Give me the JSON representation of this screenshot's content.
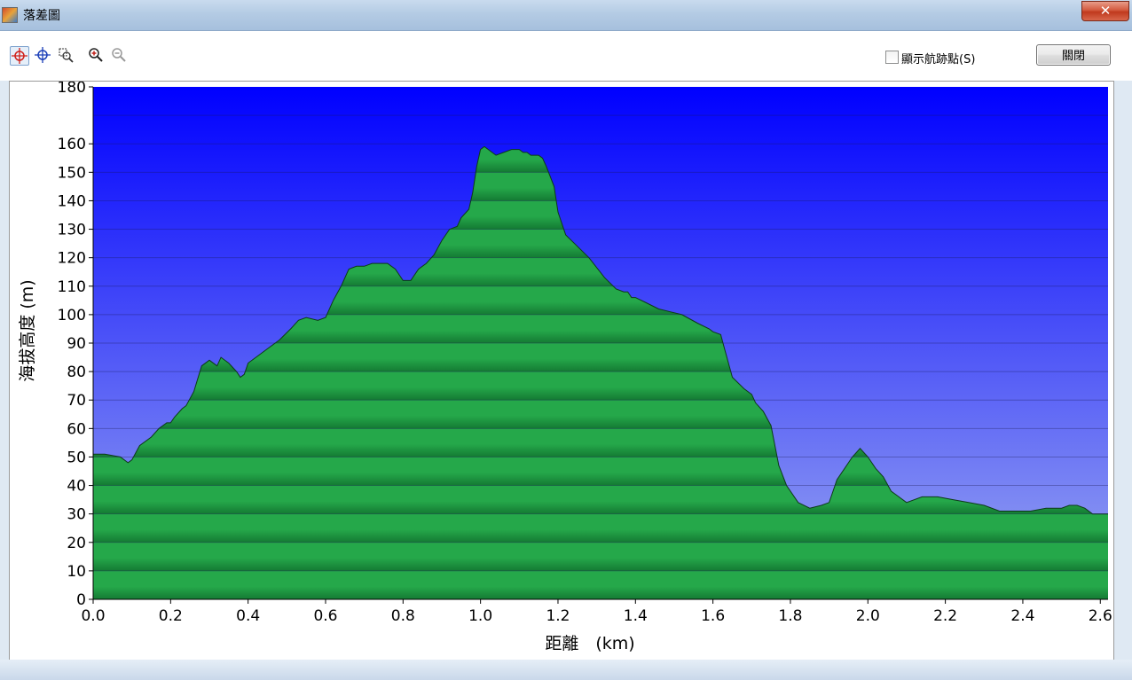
{
  "window": {
    "title": "落差圖",
    "close_glyph": "✕"
  },
  "toolbar": {
    "tools": [
      {
        "icon": "crosshair-red-icon"
      },
      {
        "icon": "crosshair-blue-icon"
      },
      {
        "icon": "zoom-box-icon"
      },
      {
        "icon": "zoom-in-icon"
      },
      {
        "icon": "zoom-out-icon"
      }
    ],
    "show_track_points_label": "顯示航跡點(S)",
    "show_track_points_checked": false,
    "close_button_label": "關閉"
  },
  "colors": {
    "plot_top": "#0000ff",
    "plot_bottom": "#9aa8f0",
    "terrain_light": "#25a84a",
    "terrain_dark": "#147a33"
  },
  "chart_data": {
    "type": "area",
    "xlabel": "距離　(km)",
    "ylabel": "海拔高度 (m)",
    "xlim": [
      0,
      2.62
    ],
    "ylim": [
      0,
      180
    ],
    "x_ticks": [
      "0.0",
      "0.2",
      "0.4",
      "0.6",
      "0.8",
      "1.0",
      "1.2",
      "1.4",
      "1.6",
      "1.8",
      "2.0",
      "2.2",
      "2.4",
      "2.6"
    ],
    "y_ticks": [
      "0",
      "10",
      "20",
      "30",
      "40",
      "50",
      "60",
      "70",
      "80",
      "90",
      "100",
      "110",
      "120",
      "130",
      "140",
      "150",
      "160",
      "180"
    ],
    "grid": true,
    "series": [
      {
        "x": [
          0.0,
          0.03,
          0.07,
          0.09,
          0.1,
          0.12,
          0.15,
          0.17,
          0.19,
          0.2,
          0.21,
          0.23,
          0.24,
          0.26,
          0.28,
          0.3,
          0.32,
          0.33,
          0.35,
          0.37,
          0.38,
          0.39,
          0.4,
          0.42,
          0.45,
          0.48,
          0.51,
          0.53,
          0.55,
          0.58,
          0.6,
          0.62,
          0.64,
          0.66,
          0.68,
          0.7,
          0.72,
          0.74,
          0.76,
          0.78,
          0.8,
          0.82,
          0.84,
          0.86,
          0.88,
          0.9,
          0.92,
          0.94,
          0.95,
          0.97,
          0.98,
          0.99,
          1.0,
          1.01,
          1.02,
          1.03,
          1.04,
          1.06,
          1.08,
          1.1,
          1.11,
          1.12,
          1.13,
          1.14,
          1.15,
          1.16,
          1.17,
          1.19,
          1.2,
          1.22,
          1.25,
          1.28,
          1.32,
          1.35,
          1.37,
          1.38,
          1.39,
          1.4,
          1.43,
          1.46,
          1.49,
          1.52,
          1.56,
          1.59,
          1.6,
          1.62,
          1.63,
          1.65,
          1.68,
          1.7,
          1.71,
          1.73,
          1.75,
          1.77,
          1.79,
          1.82,
          1.85,
          1.88,
          1.9,
          1.91,
          1.92,
          1.94,
          1.96,
          1.98,
          2.0,
          2.02,
          2.04,
          2.06,
          2.08,
          2.1,
          2.14,
          2.18,
          2.22,
          2.26,
          2.3,
          2.34,
          2.38,
          2.42,
          2.46,
          2.5,
          2.52,
          2.54,
          2.56,
          2.58,
          2.6,
          2.62
        ],
        "y": [
          51,
          51,
          50,
          48,
          49,
          54,
          57,
          60,
          62,
          62,
          64,
          67,
          68,
          73,
          82,
          84,
          82,
          85,
          83,
          80,
          78,
          79,
          83,
          85,
          88,
          91,
          95,
          98,
          99,
          98,
          99,
          105,
          110,
          116,
          117,
          117,
          118,
          118,
          118,
          116,
          112,
          112,
          116,
          118,
          121,
          126,
          130,
          131,
          134,
          137,
          143,
          152,
          158,
          159,
          158,
          157,
          156,
          157,
          158,
          158,
          157,
          157,
          156,
          156,
          156,
          155,
          152,
          145,
          136,
          128,
          124,
          120,
          113,
          109,
          108,
          108,
          106,
          106,
          104,
          102,
          101,
          100,
          97,
          95,
          94,
          93,
          88,
          78,
          74,
          72,
          69,
          66,
          61,
          47,
          40,
          34,
          32,
          33,
          34,
          38,
          42,
          46,
          50,
          53,
          50,
          46,
          43,
          38,
          36,
          34,
          36,
          36,
          35,
          34,
          33,
          31,
          31,
          31,
          32,
          32,
          33,
          33,
          32,
          30,
          30,
          30
        ]
      }
    ]
  }
}
